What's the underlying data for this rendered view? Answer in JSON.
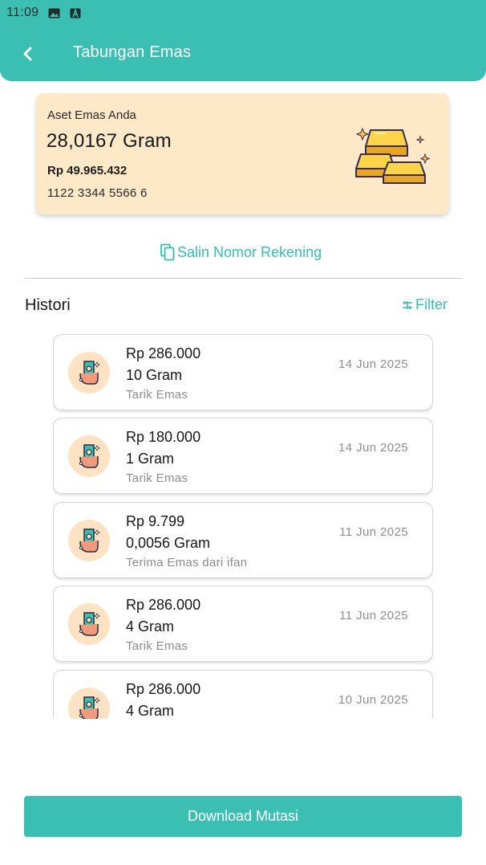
{
  "status_bar": {
    "time": "11:09",
    "icons": [
      "image-icon",
      "font-icon"
    ]
  },
  "header": {
    "title": "Tabungan Emas",
    "back_icon": "chevron-left-icon"
  },
  "asset_card": {
    "label": "Aset Emas Anda",
    "gram": "28,0167 Gram",
    "rupiah": "Rp 49.965.432",
    "account_number": "1122 3344 5566 6",
    "illustration": "gold-bars-icon"
  },
  "copy_account": {
    "label": "Salin Nomor Rekening",
    "icon": "copy-icon"
  },
  "history": {
    "title": "Histori",
    "filter_label": "Filter",
    "items": [
      {
        "amount": "Rp 286.000",
        "gram": "10 Gram",
        "desc": "Tarik Emas",
        "date": "14 Jun 2025"
      },
      {
        "amount": "Rp 180.000",
        "gram": "1 Gram",
        "desc": "Tarik Emas",
        "date": "14 Jun 2025"
      },
      {
        "amount": "Rp 9.799",
        "gram": "0,0056 Gram",
        "desc": "Terima Emas dari ifan",
        "date": "11 Jun 2025"
      },
      {
        "amount": "Rp 286.000",
        "gram": "4 Gram",
        "desc": "Tarik Emas",
        "date": "11 Jun 2025"
      },
      {
        "amount": "Rp 286.000",
        "gram": "4 Gram",
        "desc": "",
        "date": "10 Jun 2025"
      }
    ]
  },
  "footer": {
    "download_label": "Download Mutasi"
  },
  "colors": {
    "primary": "#3bbfb3",
    "card_bg": "#fde8c8",
    "icon_bg": "#fde3c3",
    "muted_text": "#8c8c8c"
  }
}
